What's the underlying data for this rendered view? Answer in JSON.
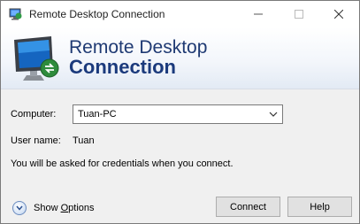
{
  "window": {
    "title": "Remote Desktop Connection",
    "controls": {
      "minimize_icon": "minimize-icon",
      "maximize_icon": "maximize-icon",
      "close_icon": "close-icon"
    }
  },
  "banner": {
    "line1": "Remote Desktop",
    "line2": "Connection",
    "icon": "remote-desktop-monitor-icon",
    "brand_color": "#1b3a7c"
  },
  "form": {
    "computer_label": "Computer:",
    "computer_value": "Tuan-PC",
    "user_label": "User name:",
    "user_value": "Tuan",
    "message": "You will be asked for credentials when you connect."
  },
  "footer": {
    "show_options_label_pre": "Show ",
    "show_options_label_underlined": "O",
    "show_options_label_post": "ptions",
    "connect_label": "Connect",
    "help_label": "Help"
  }
}
